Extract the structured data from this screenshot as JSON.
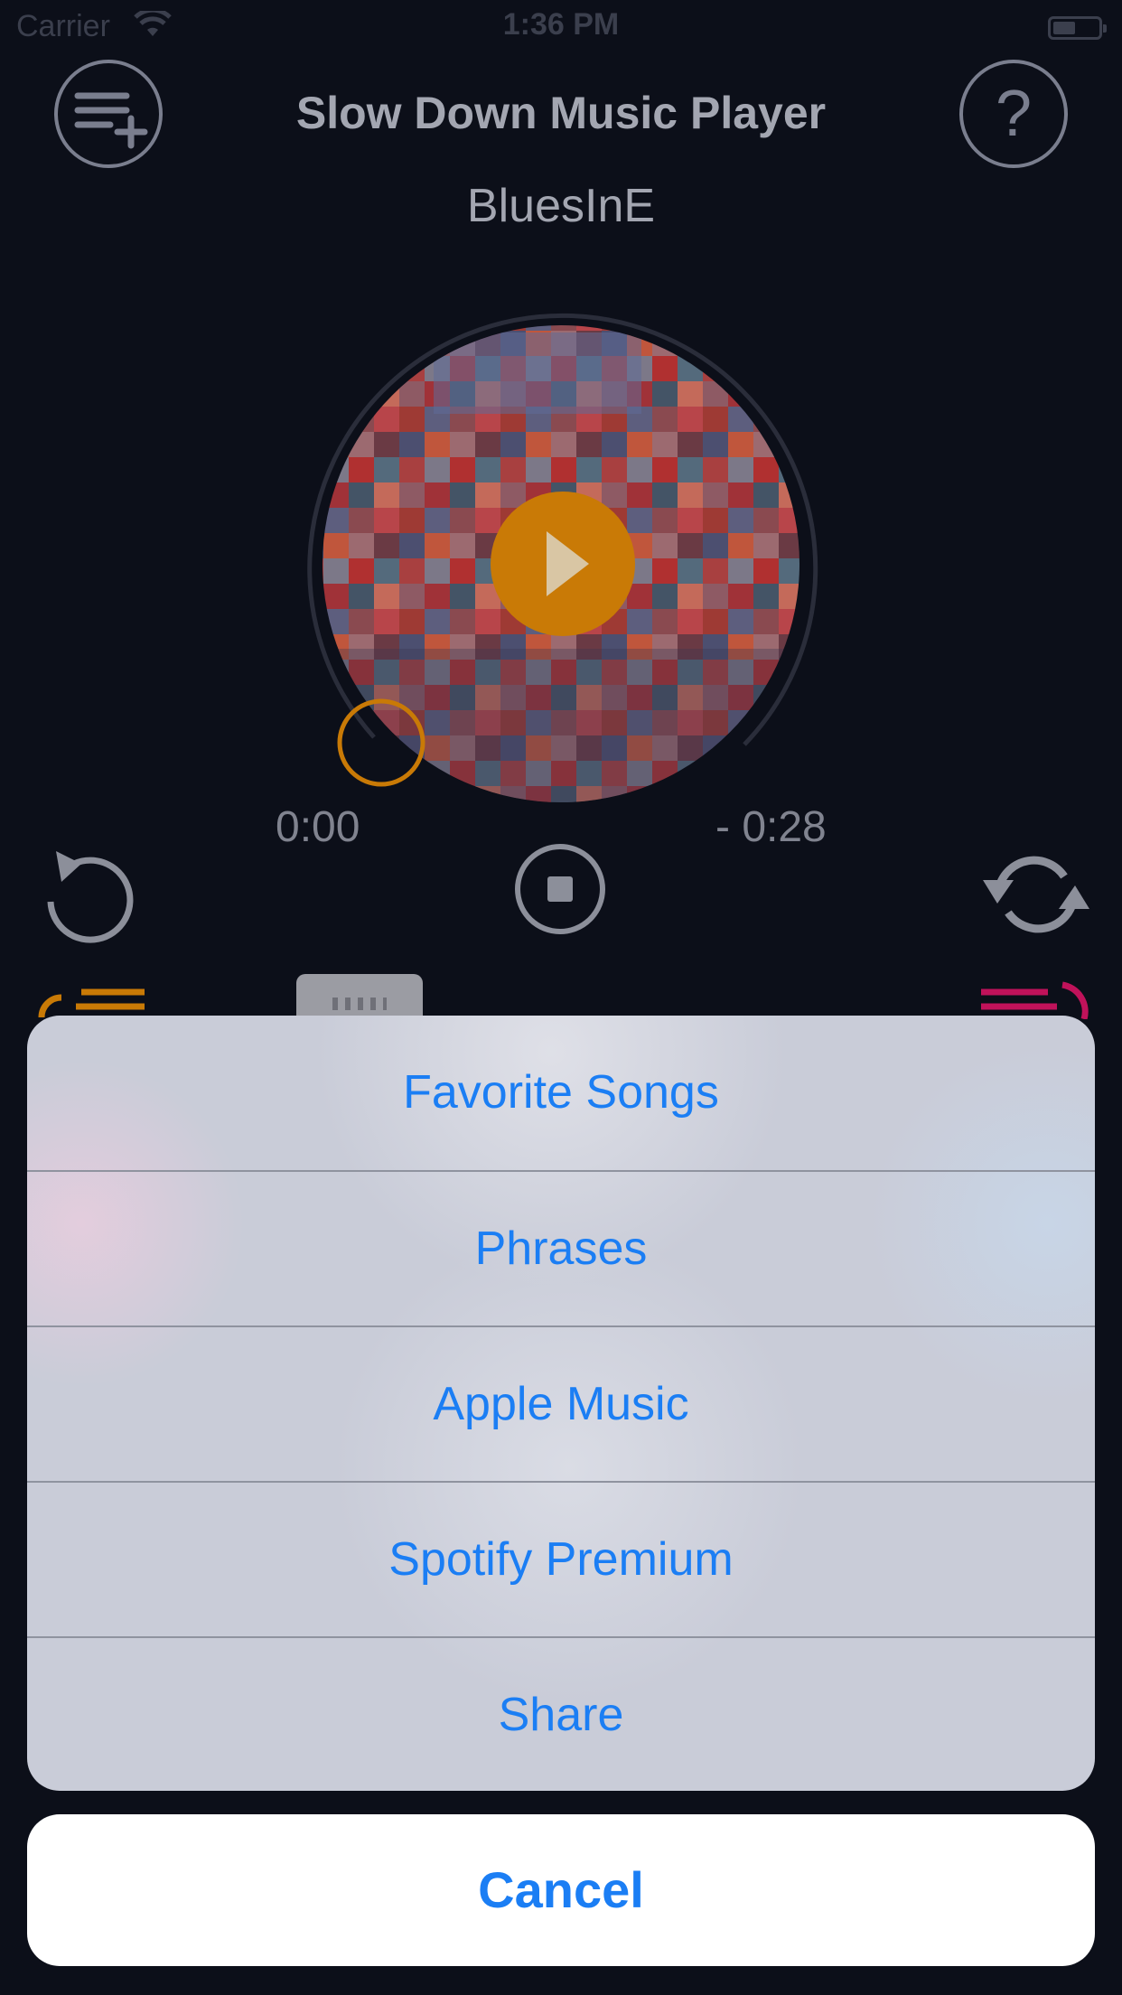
{
  "status_bar": {
    "carrier": "Carrier",
    "time": "1:36 PM"
  },
  "header": {
    "title": "Slow Down Music Player",
    "song": "BluesInE"
  },
  "player": {
    "elapsed": "0:00",
    "remaining": "- 0:28",
    "accent": "#c97a06"
  },
  "action_sheet": {
    "items": [
      "Favorite Songs",
      "Phrases",
      "Apple Music",
      "Spotify Premium",
      "Share"
    ],
    "cancel": "Cancel",
    "item_color": "#1b7ef4"
  },
  "icons": {
    "add_playlist": "playlist-add-icon",
    "help": "question-mark-icon",
    "rewind": "rewind-icon",
    "stop": "stop-icon",
    "loop": "loop-icon",
    "play": "play-icon"
  }
}
